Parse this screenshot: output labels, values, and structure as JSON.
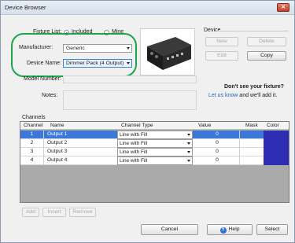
{
  "window": {
    "title": "Device Browser",
    "close": "✕"
  },
  "fixture_list": {
    "label": "Fixture List:",
    "options": [
      "Included",
      "Mine"
    ],
    "selected": "Included"
  },
  "manufacturer": {
    "label": "Manufacturer:",
    "value": "Generic"
  },
  "device_name": {
    "label": "Device Name:",
    "value": "Dimmer Pack (4 Output)"
  },
  "model_number": {
    "label": "Model Number:",
    "value": ""
  },
  "notes": {
    "label": "Notes:",
    "value": ""
  },
  "device_group": {
    "label": "Device",
    "new": "New",
    "delete": "Delete",
    "edit": "Edit",
    "copy": "Copy"
  },
  "missing": {
    "headline": "Don't see your fixture?",
    "link": "Let us know",
    "rest": " and we'll add it."
  },
  "channels": {
    "label": "Channels",
    "columns": [
      "Channel",
      "Name",
      "Channel Type",
      "Value",
      "Mask",
      "Color"
    ],
    "rows": [
      {
        "channel": "1",
        "name": "Output 1",
        "type": "Line with Fill",
        "value": "0",
        "mask": "",
        "color": "#2e2eb4",
        "selected": true
      },
      {
        "channel": "2",
        "name": "Output 2",
        "type": "Line with Fill",
        "value": "0",
        "mask": "",
        "color": "#2e2eb4"
      },
      {
        "channel": "3",
        "name": "Output 3",
        "type": "Line with Fill",
        "value": "0",
        "mask": "",
        "color": "#2e2eb4"
      },
      {
        "channel": "4",
        "name": "Output 4",
        "type": "Line with Fill",
        "value": "0",
        "mask": "",
        "color": "#2e2eb4"
      }
    ]
  },
  "row_buttons": {
    "add": "Add",
    "insert": "Insert",
    "remove": "Remove"
  },
  "footer": {
    "cancel": "Cancel",
    "help": "Help",
    "select": "Select"
  }
}
